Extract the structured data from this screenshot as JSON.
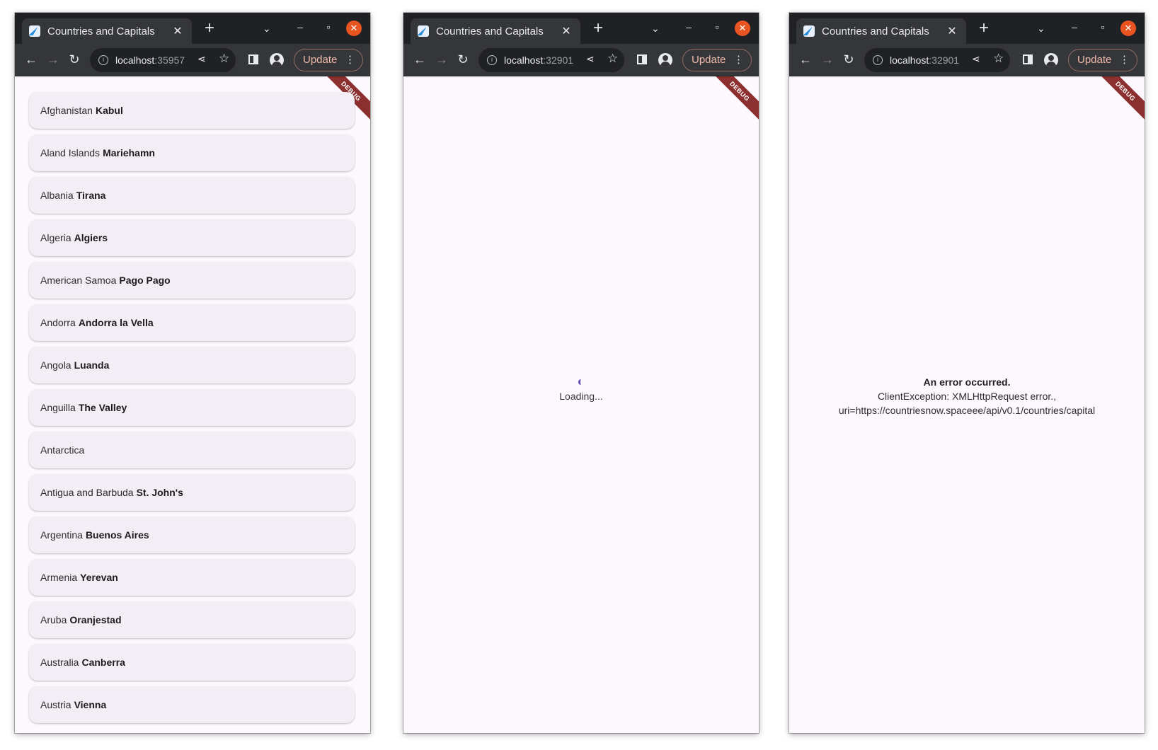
{
  "windows": [
    {
      "tab_title": "Countries and Capitals",
      "url_host": "localhost",
      "url_port": ":35957",
      "update_label": "Update",
      "debug_banner": "DEBUG"
    },
    {
      "tab_title": "Countries and Capitals",
      "url_host": "localhost",
      "url_port": ":32901",
      "update_label": "Update",
      "debug_banner": "DEBUG",
      "loading_text": "Loading..."
    },
    {
      "tab_title": "Countries and Capitals",
      "url_host": "localhost",
      "url_port": ":32901",
      "update_label": "Update",
      "debug_banner": "DEBUG",
      "error_title": "An error occurred.",
      "error_message": "ClientException: XMLHttpRequest error., uri=https://countriesnow.spaceee/api/v0.1/countries/capital"
    }
  ],
  "countries": [
    {
      "country": "Afghanistan",
      "capital": "Kabul"
    },
    {
      "country": "Aland Islands",
      "capital": "Mariehamn"
    },
    {
      "country": "Albania",
      "capital": "Tirana"
    },
    {
      "country": "Algeria",
      "capital": "Algiers"
    },
    {
      "country": "American Samoa",
      "capital": "Pago Pago"
    },
    {
      "country": "Andorra",
      "capital": "Andorra la Vella"
    },
    {
      "country": "Angola",
      "capital": "Luanda"
    },
    {
      "country": "Anguilla",
      "capital": "The Valley"
    },
    {
      "country": "Antarctica",
      "capital": ""
    },
    {
      "country": "Antigua and Barbuda",
      "capital": "St. John's"
    },
    {
      "country": "Argentina",
      "capital": "Buenos Aires"
    },
    {
      "country": "Armenia",
      "capital": "Yerevan"
    },
    {
      "country": "Aruba",
      "capital": "Oranjestad"
    },
    {
      "country": "Australia",
      "capital": "Canberra"
    },
    {
      "country": "Austria",
      "capital": "Vienna"
    }
  ],
  "icons": {
    "favicon": "flutter-icon",
    "tab_close": "close-icon",
    "new_tab": "plus-icon",
    "tab_search": "chevron-down-icon",
    "minimize": "minimize-icon",
    "maximize": "maximize-icon",
    "close_window": "close-icon",
    "back": "back-arrow-icon",
    "forward": "forward-arrow-icon",
    "reload": "reload-icon",
    "site_info": "info-icon",
    "share": "share-icon",
    "bookmark": "star-icon",
    "side_panel": "side-panel-icon",
    "profile": "profile-icon",
    "menu": "kebab-menu-icon"
  },
  "colors": {
    "titlebar": "#202124",
    "toolbar": "#35363a",
    "close_button": "#e95420",
    "page_bg": "#fdf8fd",
    "card_bg": "#f3eef6",
    "debug_banner": "#8b2f2f",
    "spinner": "#5c4ab5",
    "update_text": "#f2b8a8"
  }
}
